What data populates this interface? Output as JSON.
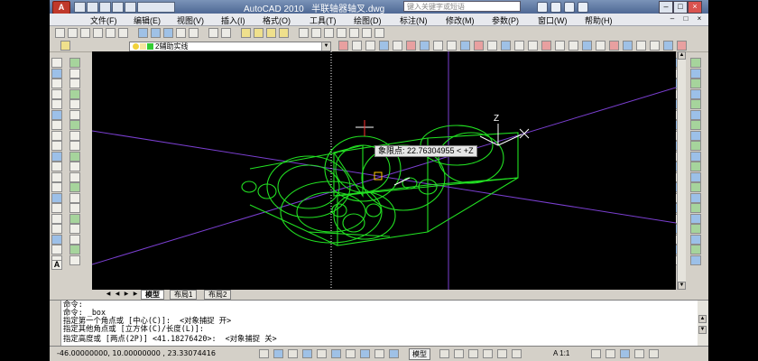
{
  "titlebar": {
    "app_name": "AutoCAD 2010",
    "file_name": "半联轴器轴叉.dwg",
    "search_placeholder": "键入关键字或短语",
    "window_controls": [
      "–",
      "□",
      "×"
    ]
  },
  "menubar": {
    "items": [
      "文件(F)",
      "编辑(E)",
      "视图(V)",
      "插入(I)",
      "格式(O)",
      "工具(T)",
      "绘图(D)",
      "标注(N)",
      "修改(M)",
      "参数(P)",
      "窗口(W)",
      "帮助(H)"
    ],
    "doc_controls": [
      "–",
      "□",
      "×"
    ]
  },
  "layer_combo": {
    "value": "2辅助实线"
  },
  "canvas": {
    "tooltip": "象限点: 22.76304955 < +Z",
    "colors": {
      "wire": "#22e022",
      "axis": "#7a3fd0",
      "cursor": "#ffffff",
      "snap": "#ffcc00"
    }
  },
  "layout_tabs": [
    "模型",
    "布局1",
    "布局2"
  ],
  "command": {
    "lines": [
      "命令:",
      "命令: _box",
      "指定第一个角点或 [中心(C)]:  <对象捕捉 开>",
      "指定其他角点或 [立方体(C)/长度(L)]:",
      "指定高度或 [两点(2P)] <41.18276420>:  <对象捕捉 关>"
    ]
  },
  "status": {
    "coords": "-46.00000000, 10.00000000 , 23.33074416",
    "model_label": "模型",
    "scale": "1:1"
  }
}
